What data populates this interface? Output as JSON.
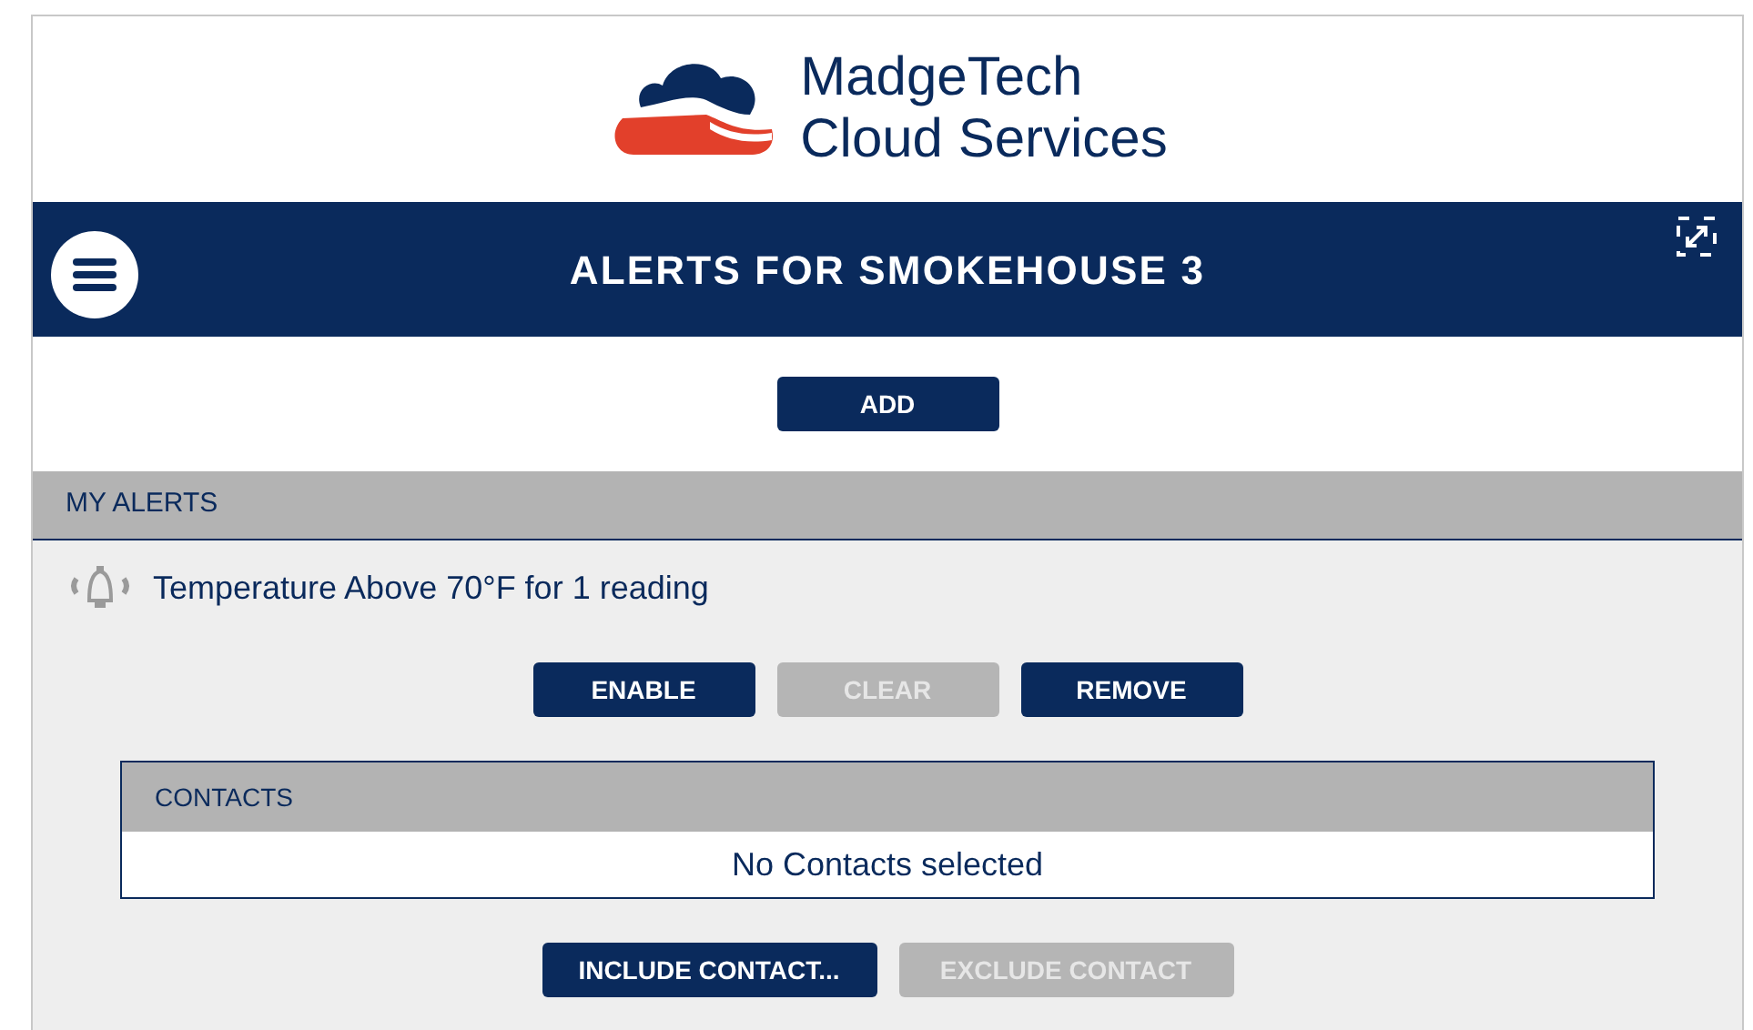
{
  "logo": {
    "line_1": "MadgeTech",
    "line_2": "Cloud Services"
  },
  "nav_bar": {
    "title": "ALERTS FOR SMOKEHOUSE 3"
  },
  "add_button": {
    "label": "ADD",
    "disabled": false
  },
  "my_alerts": {
    "heading": "MY ALERTS",
    "alerts": [
      {
        "text": "Temperature Above 70°F for 1 reading",
        "buttons": [
          {
            "label": "ENABLE",
            "disabled": false
          },
          {
            "label": "CLEAR",
            "disabled": true
          },
          {
            "label": "REMOVE",
            "disabled": false
          }
        ],
        "contacts": {
          "heading": "CONTACTS",
          "empty_text": "No Contacts selected"
        },
        "contact_buttons": [
          {
            "label": "INCLUDE CONTACT...",
            "disabled": false
          },
          {
            "label": "EXCLUDE CONTACT",
            "disabled": true
          }
        ]
      }
    ]
  }
}
